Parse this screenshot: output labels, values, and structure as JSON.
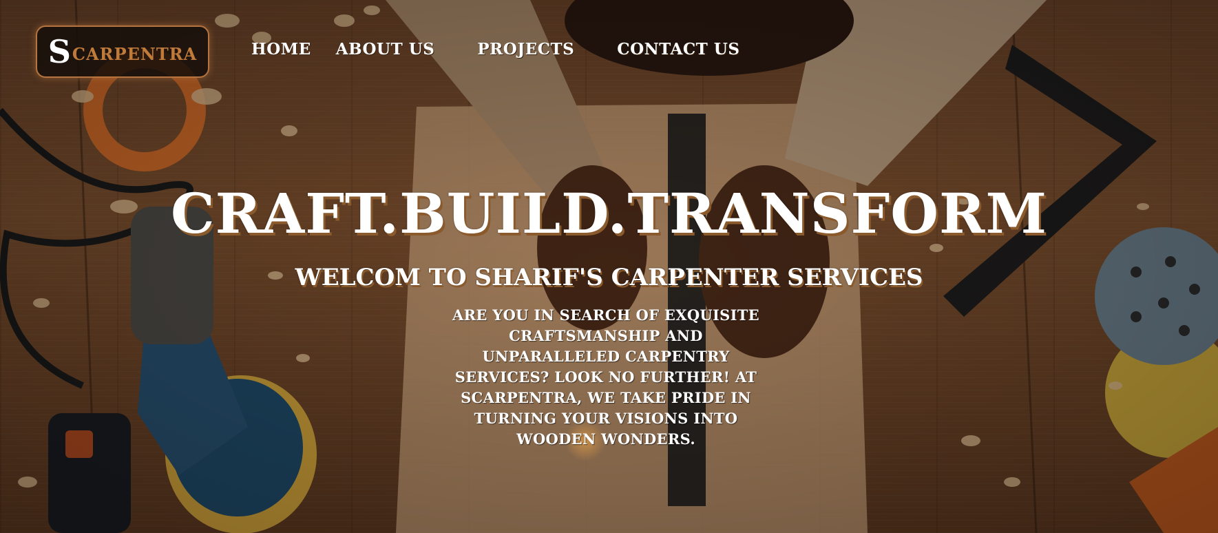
{
  "logo": {
    "initial": "S",
    "rest": "CARPENTRA"
  },
  "nav": {
    "items": [
      {
        "label": "HOME"
      },
      {
        "label": "ABOUT US"
      },
      {
        "label": "PROJECTS"
      },
      {
        "label": "CONTACT US"
      }
    ]
  },
  "hero": {
    "headline": "CRAFT.BUILD.TRANSFORM",
    "subheadline": "WELCOM TO SHARIF'S CARPENTER SERVICES",
    "paragraph": "ARE YOU IN SEARCH OF EXQUISITE CRAFTSMANSHIP AND UNPARALLELED CARPENTRY SERVICES? LOOK NO FURTHER! AT SCARPENTRA, WE TAKE PRIDE IN TURNING YOUR VISIONS INTO WOODEN WONDERS."
  },
  "colors": {
    "accent": "#c07a3a",
    "logo_border": "#b7743f",
    "text": "#ffffff",
    "text_shadow": "#8a5a2c"
  }
}
